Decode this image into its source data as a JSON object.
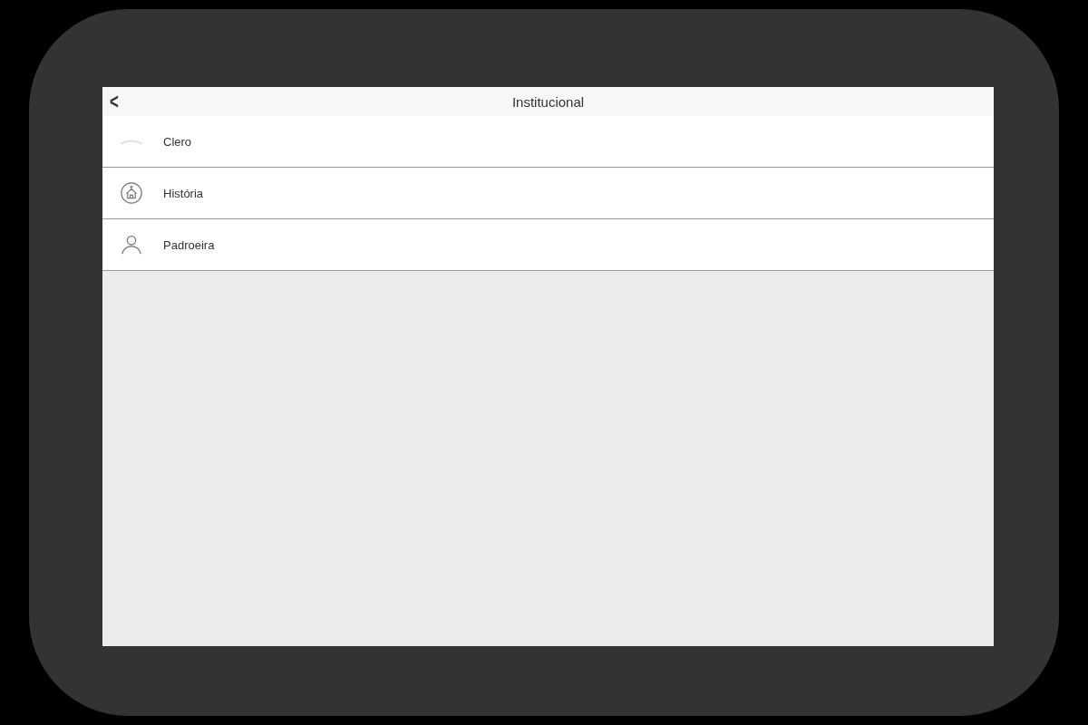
{
  "nav_bar": {
    "back": "<",
    "title": "Institucional"
  },
  "items": [
    {
      "label": "Clero",
      "kind": "clergy"
    },
    {
      "label": "História",
      "kind": "church"
    },
    {
      "label": "Padroeira",
      "kind": "person"
    }
  ]
}
